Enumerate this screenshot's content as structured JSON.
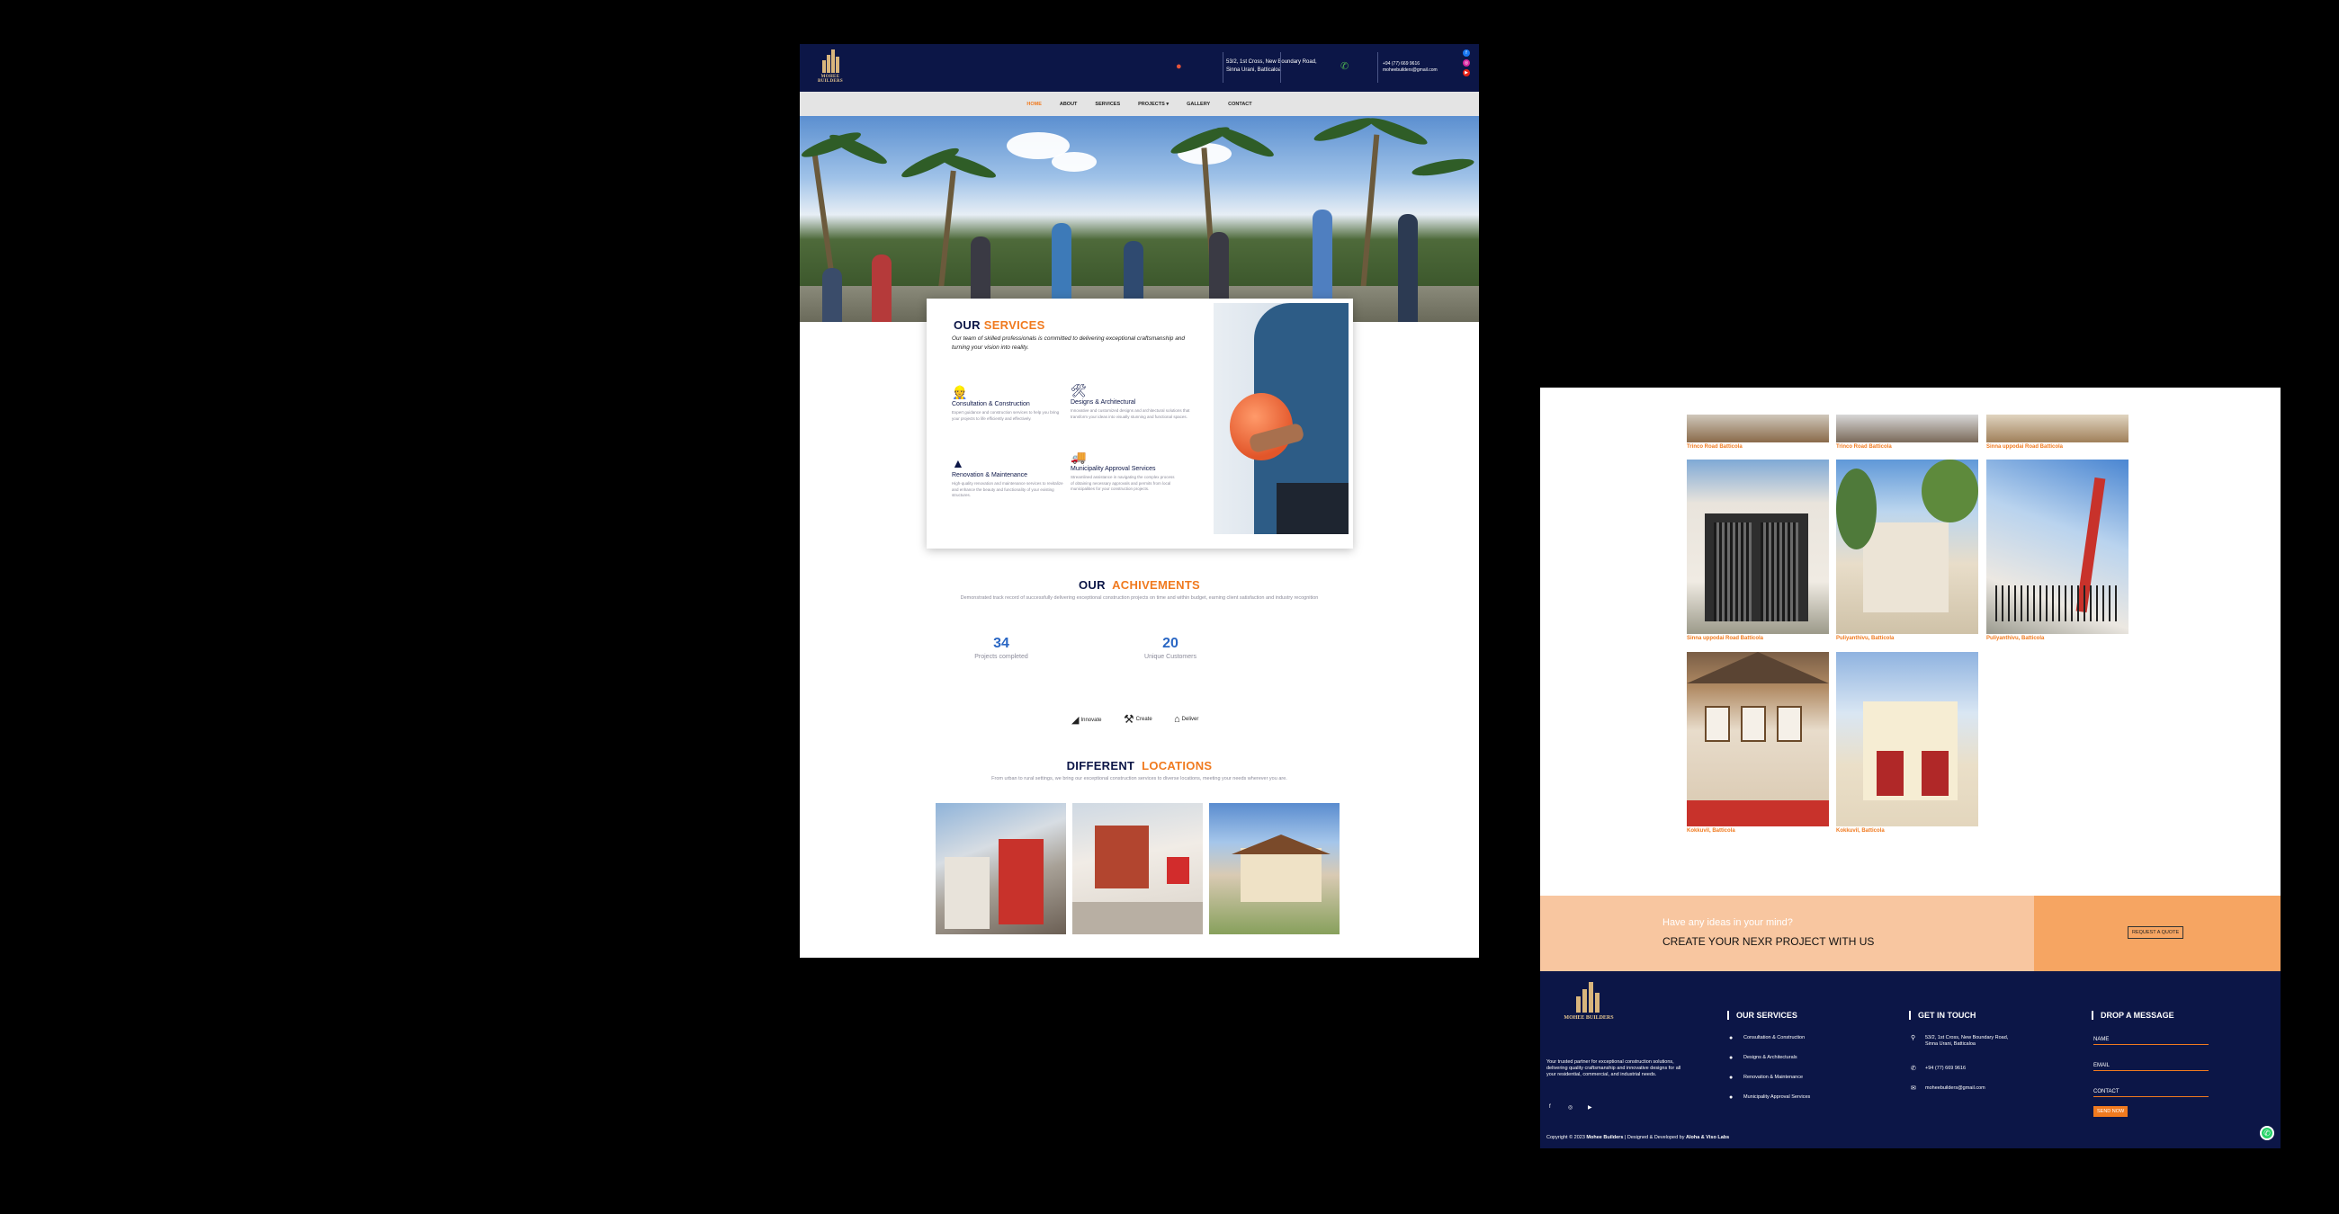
{
  "page1": {
    "brand": "MOHEE BUILDERS",
    "topbar": {
      "address": "53/2, 1st Cross, New Boundary Road,\nSinna Urani, Batticaloa",
      "phone": "+94 (77) 669 9616",
      "email": "moheebuilders@gmail.com"
    },
    "nav": [
      "HOME",
      "ABOUT",
      "SERVICES",
      "PROJECTS ▾",
      "GALLERY",
      "CONTACT"
    ],
    "services": {
      "title_a": "OUR",
      "title_b": "SERVICES",
      "subtitle": "Our team of skilled professionals is committed to delivering exceptional craftsmanship and turning your vision into reality.",
      "items": [
        {
          "icon": "worker-icon",
          "glyph": "👷",
          "title": "Consultation & Construction",
          "desc": "Expert guidance and construction services to help you bring your projects to life efficiently and effectively."
        },
        {
          "icon": "tools-icon",
          "glyph": "🛠",
          "title": "Designs & Architectural",
          "desc": "Innovative and customized designs and architectural solutions that transform your ideas into visually stunning and functional spaces."
        },
        {
          "icon": "cone-icon",
          "glyph": "▲",
          "title": "Renovation & Maintenance",
          "desc": "High-quality renovation and maintenance services to revitalize and enhance the beauty and functionality of your existing structures."
        },
        {
          "icon": "truck-icon",
          "glyph": "🚚",
          "title": "Municipality Approval Services",
          "desc": "Streamlined assistance in navigating the complex process of obtaining necessary approvals and permits from local municipalities for your construction projects."
        }
      ]
    },
    "achievements": {
      "title_a": "OUR",
      "title_b": "ACHIVEMENTS",
      "subtitle": "Demonstrated track record of successfully delivering exceptional construction projects on time and within budget, earning client satisfaction and industry recognition",
      "stats": [
        {
          "value": "34",
          "label": "Projects completed"
        },
        {
          "value": "20",
          "label": "Unique Customers"
        }
      ],
      "steps": [
        {
          "icon": "innovate-icon",
          "label": "Innovate"
        },
        {
          "icon": "create-icon",
          "label": "Create"
        },
        {
          "icon": "deliver-icon",
          "label": "Deliver"
        }
      ]
    },
    "locations": {
      "title_a": "DIFFERENT",
      "title_b": "LOCATIONS",
      "subtitle": "From urban to rural settings, we bring our exceptional construction services to diverse locations, meeting your needs wherever you are."
    }
  },
  "page2": {
    "gallery": [
      {
        "caption": "Trinco Road Batticola"
      },
      {
        "caption": "Trinco Road Batticola"
      },
      {
        "caption": "Sinna uppodai Road Batticola"
      },
      {
        "caption": "Sinna uppodai Road Batticola"
      },
      {
        "caption": "Puliyanthivu, Batticola"
      },
      {
        "caption": "Puliyanthivu, Batticola"
      },
      {
        "caption": "Kokkuvil, Batticola"
      },
      {
        "caption": "Kokkuvil, Batticola"
      }
    ],
    "cta": {
      "line1": "Have any ideas in your mind?",
      "line2": "CREATE YOUR NEXR PROJECT WITH US",
      "button": "REQUEST A QUOTE"
    },
    "footer": {
      "brand": "MOHEE BUILDERS",
      "about": "Your trusted partner for exceptional construction solutions, delivering quality craftsmanship and innovative designs for all your residential, commercial, and industrial needs.",
      "services_title": "OUR SERVICES",
      "services": [
        "Consultation & Construction",
        "Designs & Architecturals",
        "Renovation & Maintenance",
        "Municipality Approval Services"
      ],
      "contact_title": "GET IN TOUCH",
      "address": "53/2, 1st Cross, New Boundary Road,\nSinna Urani, Batticaloa",
      "phone": "+94 (77) 669 9616",
      "email": "moheebuilders@gmail.com",
      "message_title": "DROP A MESSAGE",
      "fields": [
        "NAME",
        "EMAIL",
        "CONTACT"
      ],
      "send": "SEND NOW",
      "copyright_a": "Copyright © 2023",
      "copyright_b": "Mohee Builders",
      "copyright_c": "| Designed & Developed by",
      "copyright_d": "Aloha & Viso Labs"
    }
  },
  "colors": {
    "navy": "#0c1647",
    "orange": "#f07a1f",
    "blue": "#2a67c4",
    "cta_light": "#f8c6a0",
    "cta_dark": "#f6a562"
  }
}
